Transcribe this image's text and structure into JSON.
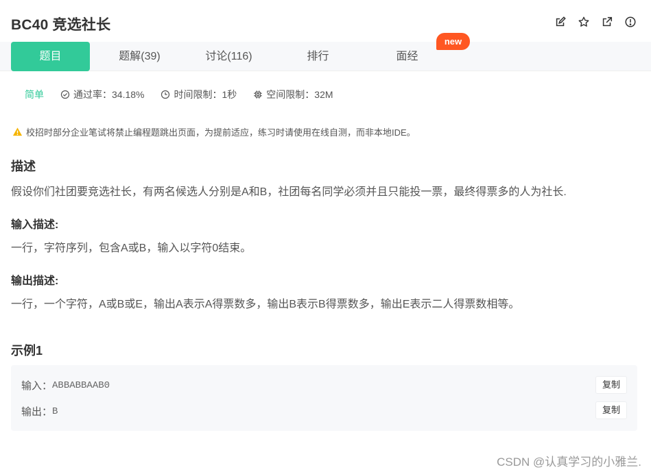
{
  "problem": {
    "title": "BC40  竞选社长"
  },
  "toolbar": {
    "icons": [
      "edit-icon",
      "star-icon",
      "external-link-icon",
      "info-icon"
    ]
  },
  "tabs": [
    {
      "label": "题目",
      "active": true
    },
    {
      "label": "题解(39)",
      "active": false
    },
    {
      "label": "讨论(116)",
      "active": false
    },
    {
      "label": "排行",
      "active": false
    },
    {
      "label": "面经",
      "active": false
    }
  ],
  "new_badge": "new",
  "meta": {
    "difficulty": "简单",
    "pass_rate": "通过率：34.18%",
    "time_limit": "时间限制：1秒",
    "memory_limit": "空间限制：32M"
  },
  "notice": "校招时部分企业笔试将禁止编程题跳出页面，为提前适应，练习时请使用在线自测，而非本地IDE。",
  "description": {
    "heading": "描述",
    "text": "假设你们社团要竞选社长，有两名候选人分别是A和B，社团每名同学必须并且只能投一票，最终得票多的人为社长."
  },
  "input_desc": {
    "heading": "输入描述:",
    "text": "一行，字符序列，包含A或B，输入以字符0结束。"
  },
  "output_desc": {
    "heading": "输出描述:",
    "text": "一行，一个字符，A或B或E，输出A表示A得票数多，输出B表示B得票数多，输出E表示二人得票数相等。"
  },
  "example": {
    "heading": "示例1",
    "input_label": "输入：",
    "input_value": "ABBABBAAB0",
    "output_label": "输出：",
    "output_value": "B",
    "copy_label": "复制"
  },
  "watermark": "CSDN @认真学习的小雅兰.",
  "colors": {
    "accent": "#32ca99",
    "badge": "#ff5722",
    "warning": "#f5b400"
  }
}
